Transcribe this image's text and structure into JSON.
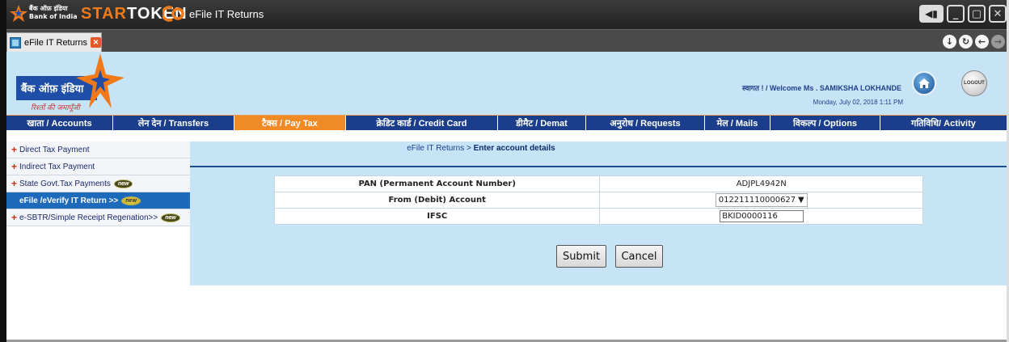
{
  "window": {
    "bank_name_hi": "बैंक ऑफ़ इंडिया",
    "bank_name_en": "Bank of India",
    "brand_star": "STAR",
    "brand_token": "TOKEN",
    "title": "eFile IT Returns",
    "controls": [
      "minimize",
      "maximize",
      "close"
    ]
  },
  "tabs": [
    {
      "label": "eFile IT Returns",
      "close": "×"
    }
  ],
  "header": {
    "logo_text": "बैंक ऑफ़ इंडिया",
    "tagline": "रिश्तों की जमापूँजी",
    "welcome": "स्वागत ! / Welcome Ms . SAMIKSHA LOKHANDE",
    "datetime": "Monday, July 02, 2018 1:11 PM",
    "logout_label": "LOGOUT"
  },
  "menu": [
    {
      "label": "खाता / Accounts",
      "active": false
    },
    {
      "label": "लेन देन / Transfers",
      "active": false
    },
    {
      "label": "टैक्स / Pay Tax",
      "active": true
    },
    {
      "label": "क्रेडिट कार्ड / Credit Card",
      "active": false
    },
    {
      "label": "डीमैट / Demat",
      "active": false
    },
    {
      "label": "अनुरोध / Requests",
      "active": false
    },
    {
      "label": "मेल / Mails",
      "active": false
    },
    {
      "label": "विकल्प / Options",
      "active": false
    },
    {
      "label": "गतिविधि/ Activity",
      "active": false
    }
  ],
  "sidebar": {
    "items": [
      {
        "label": "Direct Tax Payment",
        "badge": ""
      },
      {
        "label": "Indirect Tax Payment",
        "badge": ""
      },
      {
        "label": "State Govt.Tax Payments",
        "badge": "new"
      },
      {
        "label": "eFile /eVerify IT Return >>",
        "badge": "new"
      },
      {
        "label": "e-SBTR/Simple Receipt Regenation>>",
        "badge": "new"
      }
    ]
  },
  "breadcrumb": {
    "parent": "eFile IT Returns",
    "separator": " > ",
    "current": "Enter account details"
  },
  "form": {
    "rows": [
      {
        "label": "PAN (Permanent Account Number)",
        "value": "ADJPL4942N"
      },
      {
        "label": "From (Debit) Account",
        "value": "012211110000627"
      },
      {
        "label": "IFSC",
        "value": "BKID0000116"
      }
    ],
    "submit_label": "Submit",
    "cancel_label": "Cancel"
  },
  "colors": {
    "menu_bg": "#1a3e8c",
    "menu_active": "#f08a24",
    "header_bg": "#c7e4f6",
    "sidebar_selected": "#1e6aba"
  }
}
